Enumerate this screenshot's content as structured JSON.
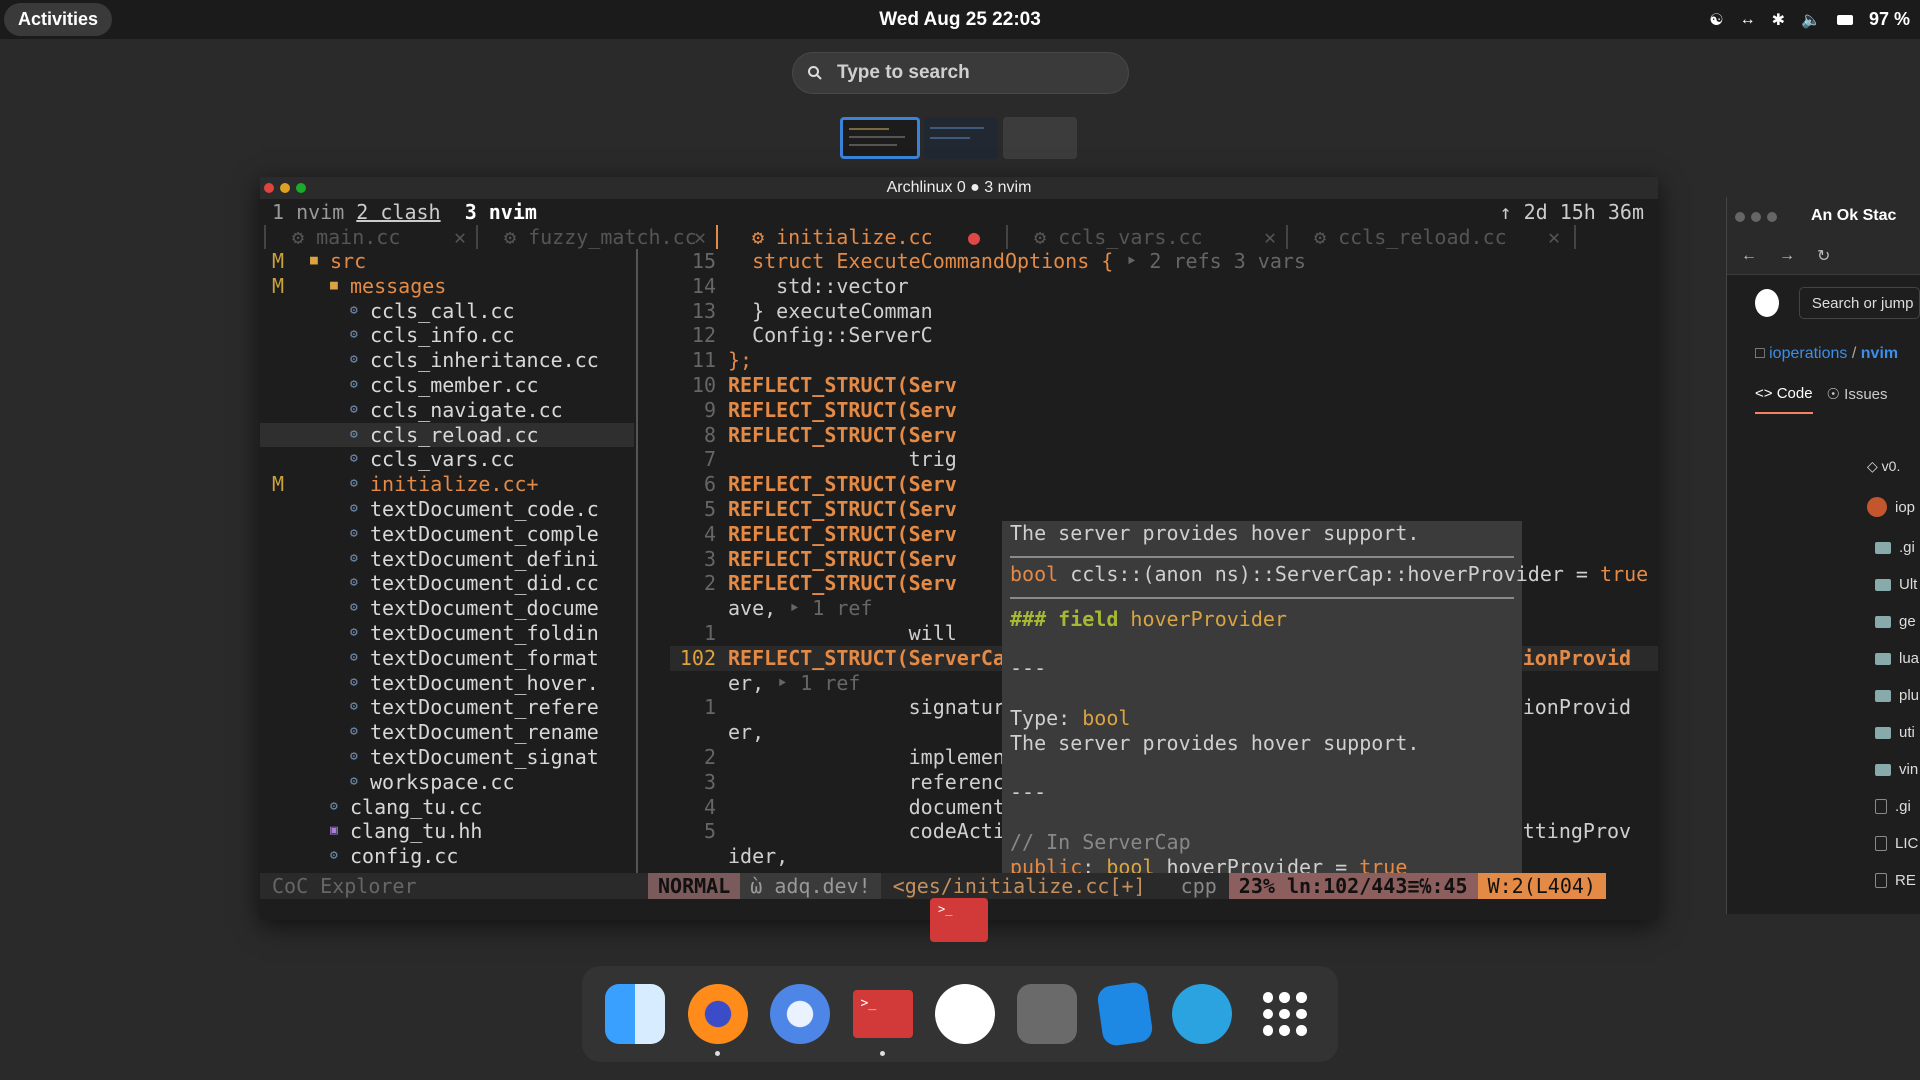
{
  "topbar": {
    "activities": "Activities",
    "clock": "Wed Aug 25  22:03",
    "battery": "97 %"
  },
  "search": {
    "placeholder": "Type to search"
  },
  "terminal": {
    "title": "Archlinux 0 ● 3 nvim",
    "tmux_windows": [
      "1 nvim",
      "2 clash",
      "3 nvim"
    ],
    "uptime": "↑ 2d 15h 36m",
    "tabs": [
      {
        "label": "main.cc",
        "close": "✕"
      },
      {
        "label": "fuzzy_match.cc",
        "close": "✕"
      },
      {
        "label": "initialize.cc",
        "close": "●"
      },
      {
        "label": "ccls_vars.cc",
        "close": "✕"
      },
      {
        "label": "ccls_reload.cc",
        "close": "✕"
      }
    ],
    "explorer": [
      {
        "flag": "M",
        "name": "src",
        "indent": 0,
        "folder": true
      },
      {
        "flag": "M",
        "name": "messages",
        "indent": 1,
        "folder": true
      },
      {
        "flag": "",
        "name": "ccls_call.cc",
        "indent": 2
      },
      {
        "flag": "",
        "name": "ccls_info.cc",
        "indent": 2
      },
      {
        "flag": "",
        "name": "ccls_inheritance.cc",
        "indent": 2
      },
      {
        "flag": "",
        "name": "ccls_member.cc",
        "indent": 2
      },
      {
        "flag": "",
        "name": "ccls_navigate.cc",
        "indent": 2
      },
      {
        "flag": "",
        "name": "ccls_reload.cc",
        "indent": 2,
        "selected": true
      },
      {
        "flag": "",
        "name": "ccls_vars.cc",
        "indent": 2
      },
      {
        "flag": "M",
        "name": "initialize.cc+",
        "indent": 2,
        "modified": true
      },
      {
        "flag": "",
        "name": "textDocument_code.c",
        "indent": 2
      },
      {
        "flag": "",
        "name": "textDocument_comple",
        "indent": 2
      },
      {
        "flag": "",
        "name": "textDocument_defini",
        "indent": 2
      },
      {
        "flag": "",
        "name": "textDocument_did.cc",
        "indent": 2
      },
      {
        "flag": "",
        "name": "textDocument_docume",
        "indent": 2
      },
      {
        "flag": "",
        "name": "textDocument_foldin",
        "indent": 2
      },
      {
        "flag": "",
        "name": "textDocument_format",
        "indent": 2
      },
      {
        "flag": "",
        "name": "textDocument_hover.",
        "indent": 2
      },
      {
        "flag": "",
        "name": "textDocument_refere",
        "indent": 2
      },
      {
        "flag": "",
        "name": "textDocument_rename",
        "indent": 2
      },
      {
        "flag": "",
        "name": "textDocument_signat",
        "indent": 2
      },
      {
        "flag": "",
        "name": "workspace.cc",
        "indent": 2
      },
      {
        "flag": "",
        "name": "clang_tu.cc",
        "indent": 1
      },
      {
        "flag": "",
        "name": "clang_tu.hh",
        "indent": 1,
        "header": true
      },
      {
        "flag": "",
        "name": "config.cc",
        "indent": 1
      }
    ],
    "code": [
      {
        "ln": "15",
        "text": "  struct ExecuteCommandOptions {",
        "virt": " ‣ 2 refs 3 vars",
        "kind": "kw"
      },
      {
        "ln": "14",
        "text": "    std::vector",
        "kind": "t"
      },
      {
        "ln": "13",
        "text": "  } executeComman",
        "kind": "t"
      },
      {
        "ln": "12",
        "text": "  Config::ServerC",
        "kind": "t"
      },
      {
        "ln": "11",
        "text": "};",
        "kind": "kw"
      },
      {
        "ln": "10",
        "text": "REFLECT_STRUCT(Serv",
        "kind": "mac"
      },
      {
        "ln": "9",
        "text": "REFLECT_STRUCT(Serv",
        "kind": "mac"
      },
      {
        "ln": "8",
        "text": "REFLECT_STRUCT(Serv",
        "kind": "mac"
      },
      {
        "ln": "7",
        "text": "               trig",
        "kind": "t"
      },
      {
        "ln": "6",
        "text": "REFLECT_STRUCT(Serv",
        "kind": "mac"
      },
      {
        "ln": "5",
        "text": "REFLECT_STRUCT(Serv",
        "kind": "mac"
      },
      {
        "ln": "4",
        "text": "REFLECT_STRUCT(Serv",
        "kind": "mac"
      },
      {
        "ln": "3",
        "text": "REFLECT_STRUCT(Serv",
        "kind": "mac"
      },
      {
        "ln": "2",
        "text": "REFLECT_STRUCT(Serv",
        "kind": "mac"
      },
      {
        "ln": "",
        "text": "ave,",
        "virt": " ‣ 1 ref",
        "kind": "t"
      },
      {
        "ln": "1",
        "text": "               will",
        "kind": "t"
      },
      {
        "ln": "102",
        "text": "REFLECT_STRUCT(ServerCap, textDocumentSync, hoverProvider, completionProvid",
        "kind": "mac",
        "current": true
      },
      {
        "ln": "",
        "text": "er,",
        "virt": " ‣ 1 ref",
        "kind": "t"
      },
      {
        "ln": "1",
        "text": "               signatureHelpProvider, declarationProvider, definitionProvid",
        "kind": "t"
      },
      {
        "ln": "",
        "text": "er,",
        "kind": "t"
      },
      {
        "ln": "2",
        "text": "               implementationProvider, typeDefinitionProvider,",
        "kind": "t"
      },
      {
        "ln": "3",
        "text": "               referencesProvider, documentHighlightProvider,",
        "kind": "t"
      },
      {
        "ln": "4",
        "text": "               documentSymbolProvider, workspaceSymbolProvider,",
        "kind": "t"
      },
      {
        "ln": "5",
        "text": "               codeActionProvider, codeLensProvider, documentFormattingProv",
        "kind": "t"
      },
      {
        "ln": "",
        "text": "ider,",
        "kind": "t"
      }
    ],
    "hover": {
      "line1": "The server provides hover support.",
      "sig_type": "bool",
      "sig_rest": " ccls::(anon ns)::ServerCap::hoverProvider = ",
      "sig_val": "true",
      "field_hash": "### field",
      "field_name": " hoverProvider",
      "dash": "---",
      "type_label": "Type: ",
      "type_val": "bool",
      "line2": "The server provides hover support.",
      "comment": "// In ServerCap",
      "decl_public": "public",
      "decl_colon": ": ",
      "decl_type": "bool",
      "decl_rest": " hoverProvider = ",
      "decl_val": "true"
    },
    "status": {
      "explorer": "CoC Explorer",
      "mode": "NORMAL",
      "git": "ὼ adq.dev!",
      "file": "<ges/initialize.cc[+]",
      "filetype": "cpp",
      "position": "23% ln:102/443≡℅:45",
      "warning": "W:2(L404)"
    }
  },
  "browser": {
    "title": "An Ok Stac",
    "search": "Search or jump",
    "repo_owner": "ioperations",
    "repo_name": "nvim",
    "tabs": [
      "Code",
      "Issues"
    ],
    "tag": "v0.",
    "user": "iop",
    "files": [
      ".gi",
      "Ult",
      "ge",
      "lua",
      "plu",
      "uti",
      "vin",
      ".gi",
      "LIC",
      "RE"
    ]
  },
  "colors": {
    "accent": "#e48a47",
    "macro": "#e48a47",
    "hover_bg": "#3b3b3b",
    "focus": "#3a83d8"
  }
}
